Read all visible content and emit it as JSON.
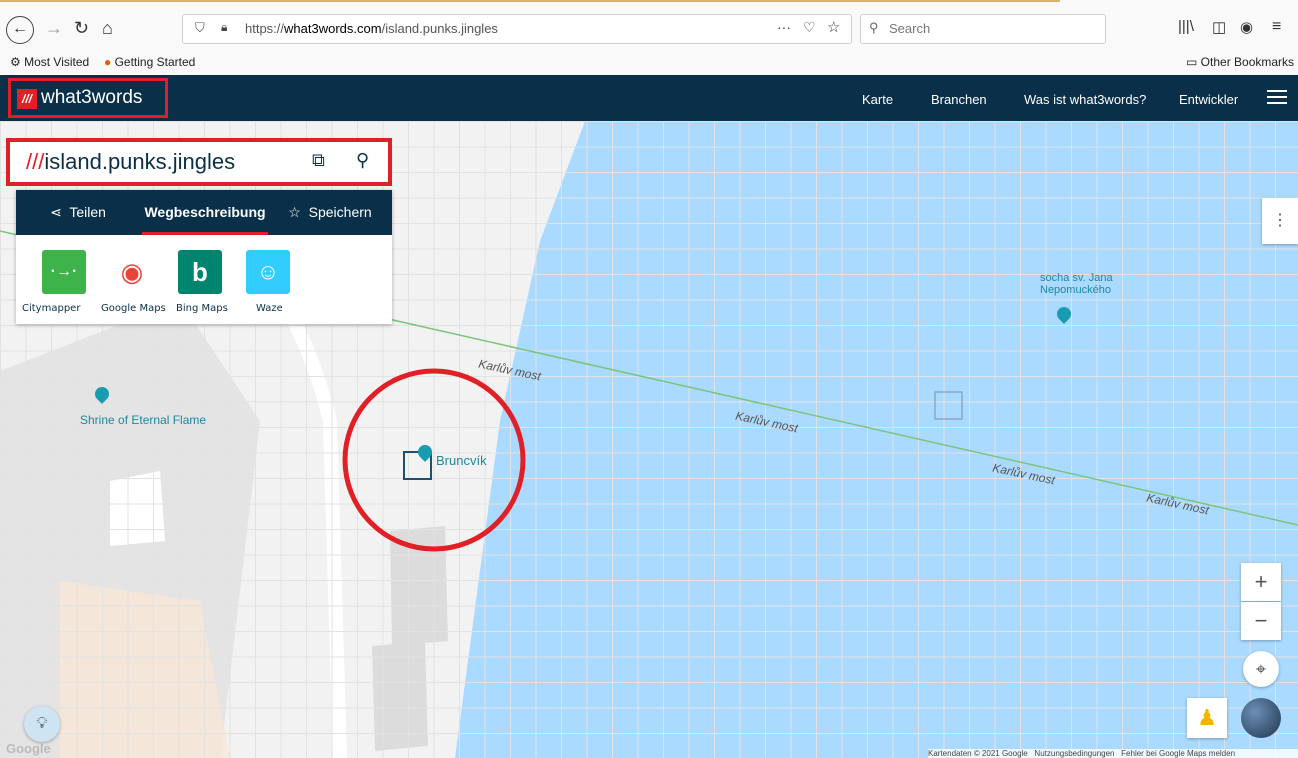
{
  "browser": {
    "url_prefix": "https://",
    "url_domain": "what3words.com",
    "url_path": "/island.punks.jingles",
    "search_placeholder": "Search",
    "bookmarks": [
      "Most Visited",
      "Getting Started"
    ],
    "other_bookmarks": "Other Bookmarks"
  },
  "header": {
    "brand": "what3words",
    "brand_mark": "///",
    "nav": [
      "Karte",
      "Branchen",
      "Was ist what3words?",
      "Entwickler"
    ]
  },
  "address": {
    "slashes": "///",
    "words": "island.punks.jingles"
  },
  "tabs": [
    "Teilen",
    "Wegbeschreibung",
    "Speichern"
  ],
  "apps": [
    "Citymapper",
    "Google Maps",
    "Bing Maps",
    "Waze"
  ],
  "map_labels": {
    "shrine": "Shrine of Eternal Flame",
    "bruncvik": "Bruncvík",
    "statue": "socha sv. Jana Nepomuckého",
    "bridge": "Karlův most",
    "logo": "Google",
    "footer_data": "Kartendaten © 2021 Google",
    "footer_terms": "Nutzungsbedingungen",
    "footer_report": "Fehler bei Google Maps melden"
  },
  "colors": {
    "accent": "#e11f26",
    "navy": "#0a3049",
    "water": "#aadaff"
  }
}
